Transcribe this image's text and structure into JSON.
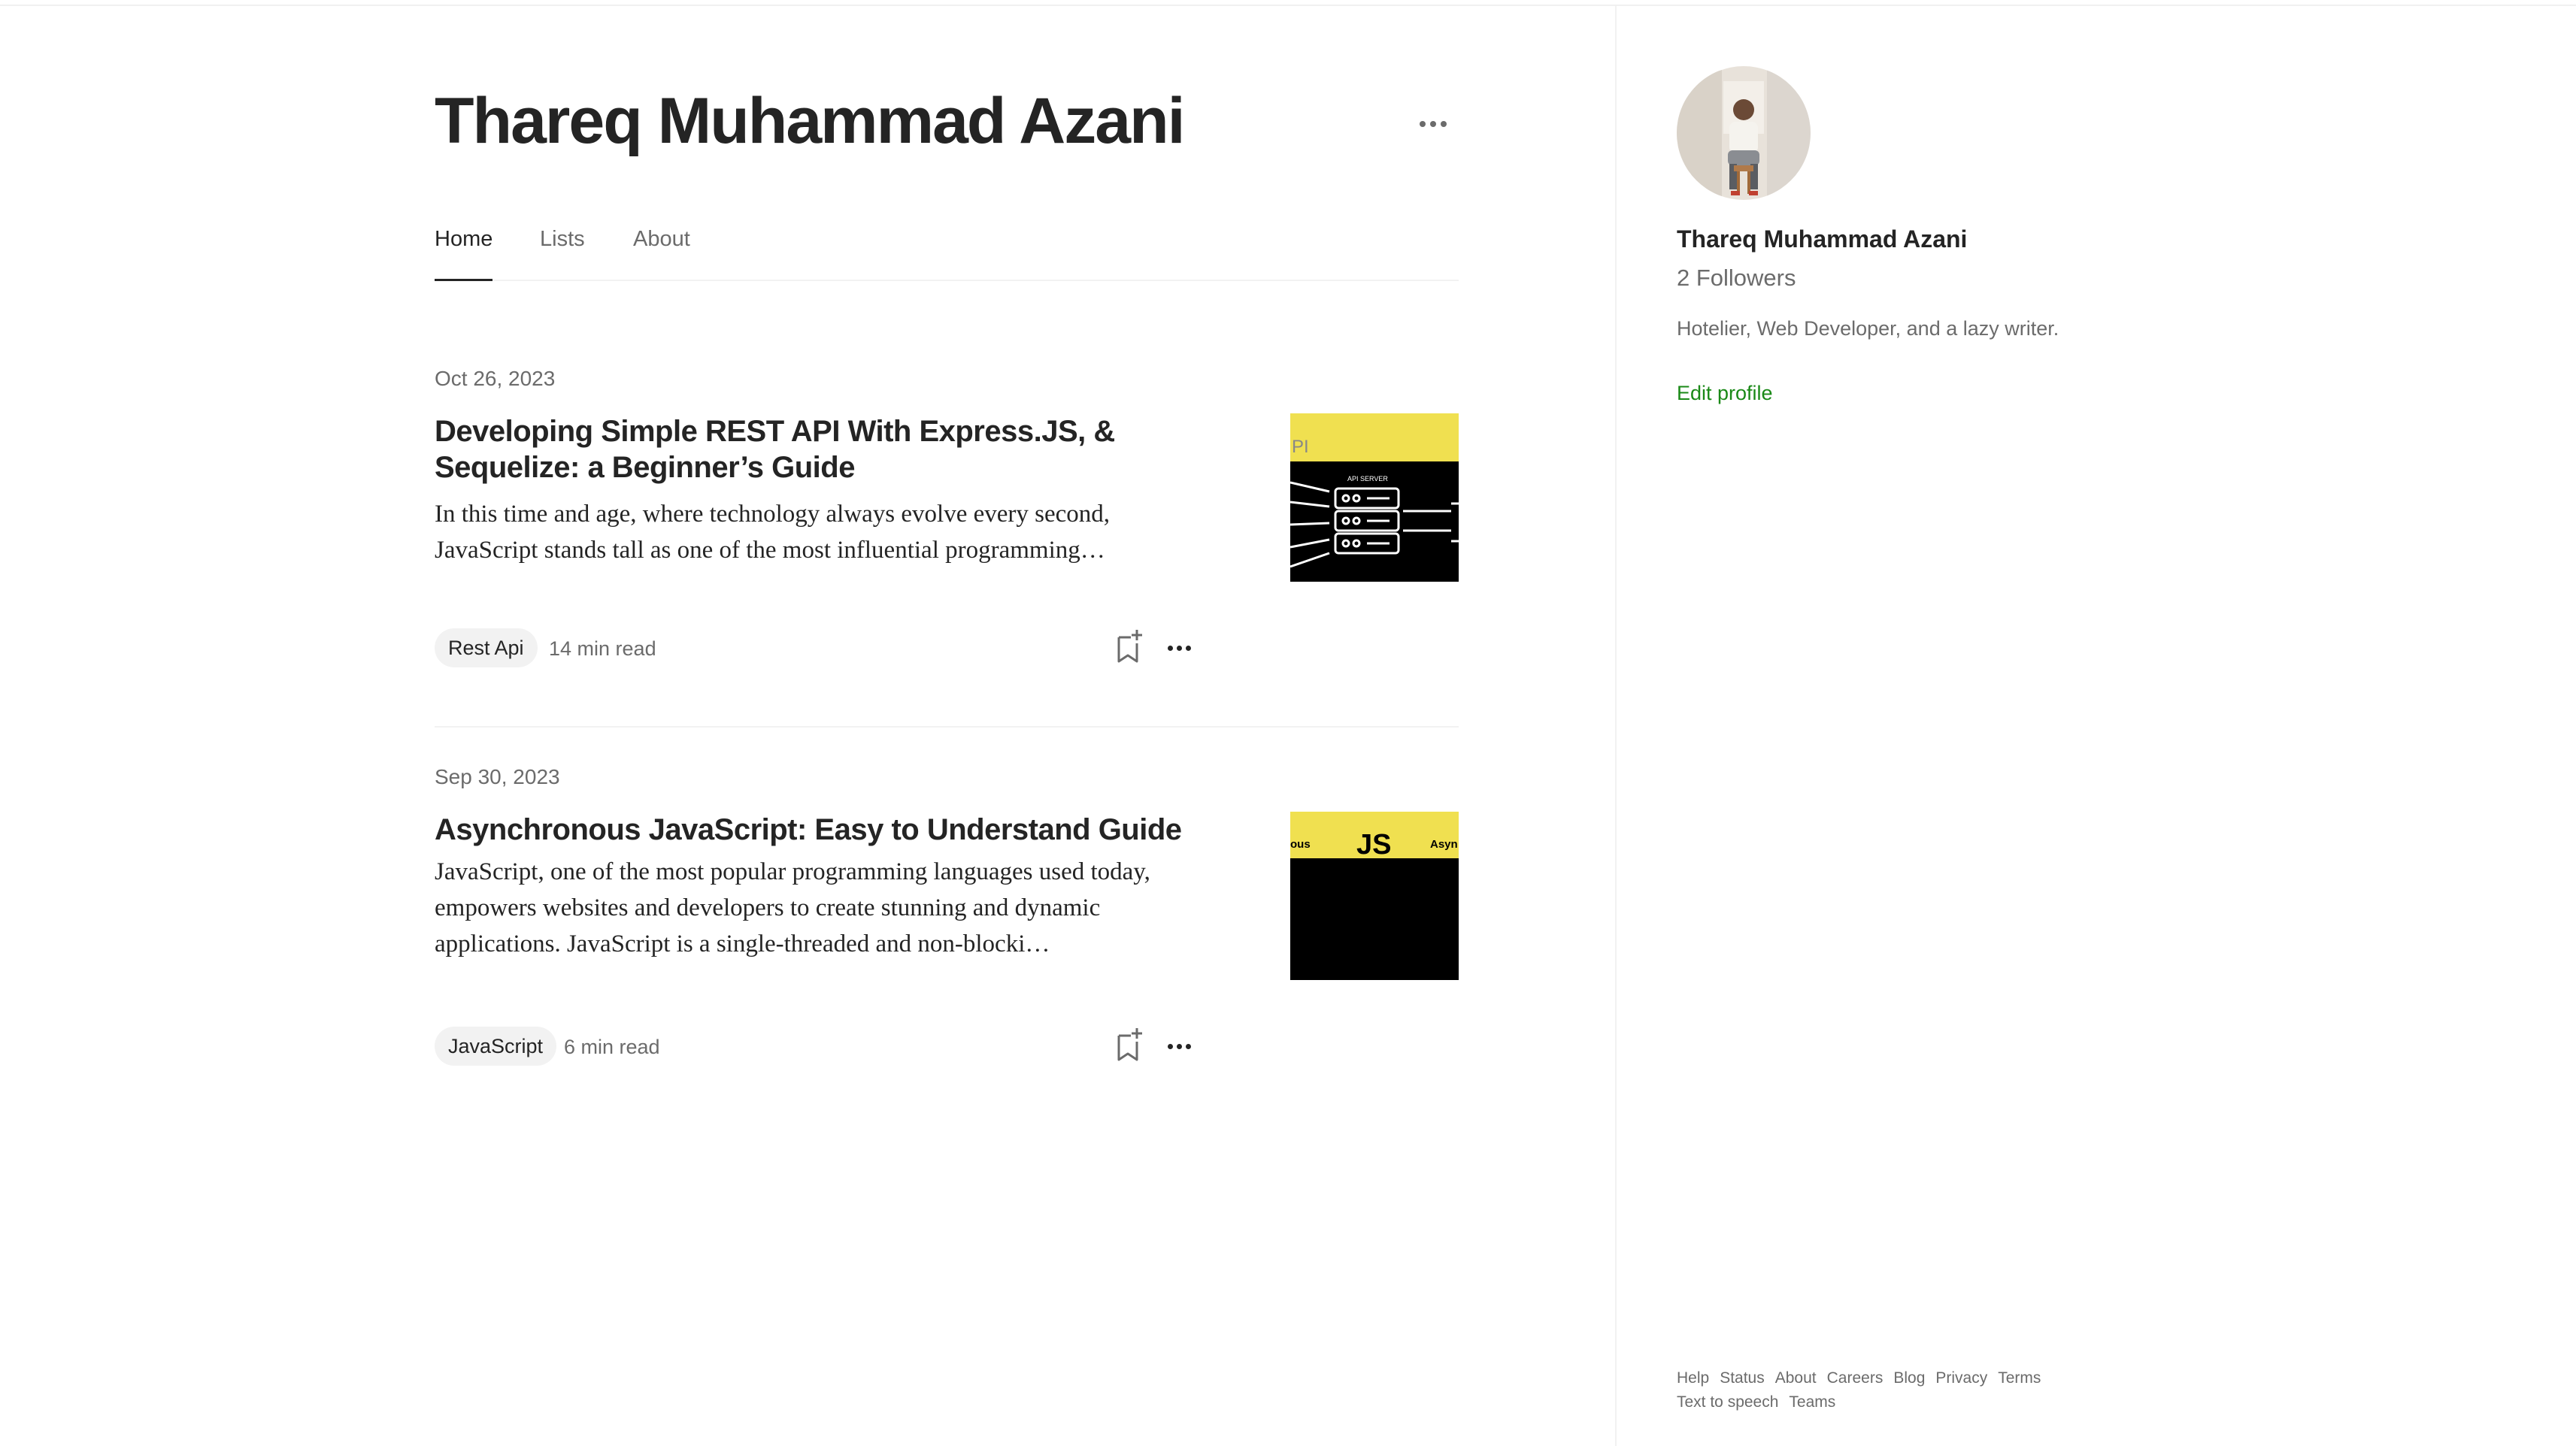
{
  "profile": {
    "name": "Thareq Muhammad Azani",
    "followers": "2 Followers",
    "bio": "Hotelier, Web Developer, and a lazy writer.",
    "edit_profile_label": "Edit profile"
  },
  "tabs": [
    {
      "label": "Home",
      "active": true
    },
    {
      "label": "Lists",
      "active": false
    },
    {
      "label": "About",
      "active": false
    }
  ],
  "articles": [
    {
      "date": "Oct 26, 2023",
      "title": "Developing Simple REST API With Express.JS, & Sequelize: a Beginner’s Guide",
      "snippet": "In this time and age, where technology always evolve every second, JavaScript stands tall as one of the most influential programming…",
      "tag": "Rest Api",
      "read_time": "14 min read",
      "thumb_text": "PI",
      "thumb_caption": "API SERVER"
    },
    {
      "date": "Sep 30, 2023",
      "title": "Asynchronous JavaScript: Easy to Understand Guide",
      "snippet": "JavaScript, one of the most popular programming languages used today, empowers websites and developers to create stunning and dynamic applications. JavaScript is a single-threaded and non-blocki…",
      "tag": "JavaScript",
      "read_time": "6 min read",
      "thumb_left": "ous",
      "thumb_center": "JS",
      "thumb_right": "Asyn"
    }
  ],
  "footer": [
    "Help",
    "Status",
    "About",
    "Careers",
    "Blog",
    "Privacy",
    "Terms",
    "Text to speech",
    "Teams"
  ],
  "colors": {
    "accent_green": "#1a8917",
    "thumb_yellow": "#f0e050",
    "text": "#242424",
    "muted": "#6b6b6b"
  },
  "icons": [
    "more-icon",
    "bookmark-add-icon",
    "more-horizontal-icon"
  ]
}
